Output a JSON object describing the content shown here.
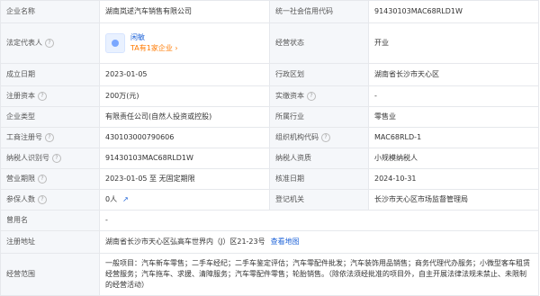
{
  "rows": [
    {
      "l1": "企业名称",
      "v1": "湖南岚逑汽车销售有限公司",
      "l2": "统一社会信用代码",
      "v2": "91430103MAC68RLD1W"
    },
    {
      "l1": "法定代表人",
      "v1_name": "闲敏",
      "v1_sub": "TA有1家企业",
      "l2": "经营状态",
      "v2": "开业"
    },
    {
      "l1": "成立日期",
      "v1": "2023-01-05",
      "l2": "行政区划",
      "v2": "湖南省长沙市天心区"
    },
    {
      "l1": "注册资本",
      "v1": "200万(元)",
      "l2": "实缴资本",
      "v2": "-"
    },
    {
      "l1": "企业类型",
      "v1": "有限责任公司(自然人投资或控股)",
      "l2": "所属行业",
      "v2": "零售业"
    },
    {
      "l1": "工商注册号",
      "v1": "430103000790606",
      "l2": "组织机构代码",
      "v2": "MAC68RLD-1"
    },
    {
      "l1": "纳税人识别号",
      "v1": "91430103MAC68RLD1W",
      "l2": "纳税人资质",
      "v2": "小规模纳税人"
    },
    {
      "l1": "营业期限",
      "v1": "2023-01-05 至 无固定期限",
      "l2": "核准日期",
      "v2": "2024-10-31"
    },
    {
      "l1": "参保人数",
      "v1": "0人",
      "l2": "登记机关",
      "v2": "长沙市天心区市场监督管理局"
    },
    {
      "l1": "曾用名",
      "v1": "-"
    },
    {
      "l1": "注册地址",
      "v1": "湖南省长沙市天心区弘高车世界内（J）区21-23号",
      "v1_link": "查看地图"
    },
    {
      "l1": "经营范围",
      "v1": "一般项目：汽车新车零售；二手车经纪；二手车鉴定评估；汽车零配件批发；汽车装饰用品销售；商务代理代办服务；小微型客车租赁经营服务；汽车拖车、求援、清障服务；汽车零配件零售；轮胎销售。（除依法须经批准的项目外，自主开展法律法规未禁止、未限制的经营活动）"
    }
  ],
  "icons": {
    "help": "?",
    "chevron": "›",
    "chart": "↗"
  },
  "colors": {
    "accent": "#1e63d8",
    "orange": "#ff7a00",
    "label_bg": "#f5f7fa",
    "border": "#e6e8ec"
  }
}
